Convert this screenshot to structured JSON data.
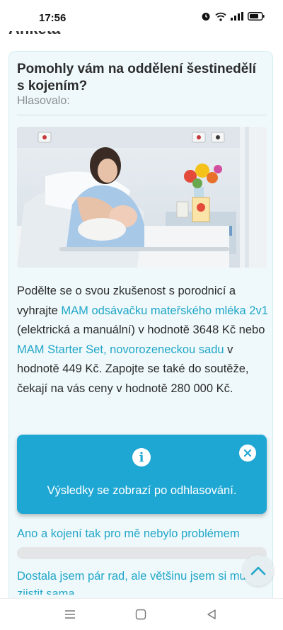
{
  "status": {
    "time": "17:56"
  },
  "page": {
    "heading": "Anketa"
  },
  "poll": {
    "question": "Pomohly vám na oddělení šestinedělí s kojením?",
    "voted_label": "Hlasovalo:",
    "description": {
      "p1": "Podělte se o svou zkušenost s porodnicí a vyhrajte ",
      "link1": "MAM odsávačku mateřského mléka 2v1",
      "p2": " (elektrická a manuální) v hodnotě 3648 Kč nebo ",
      "link2": "MAM Starter Set, novorozeneckou sadu",
      "p3": " v hodnotě 449 Kč. Zapojte se také do soutěže, čekají na vás ceny v hodnotě 280 000 Kč."
    },
    "info_box": {
      "text": "Výsledky se zobrazí po odhlasování."
    },
    "options": [
      {
        "label": "Ano a kojení tak pro mě nebylo problémem"
      },
      {
        "label": "Dostala jsem pár rad, ale většinu jsem si musela zjistit sama"
      }
    ]
  },
  "colors": {
    "accent": "#21a6c8",
    "info_bg": "#1fa7d4",
    "card_bg": "#eff9fb"
  },
  "icons": [
    "alarm-icon",
    "wifi-icon",
    "signal-icon",
    "battery-icon",
    "info-icon",
    "close-icon",
    "chevron-up-icon",
    "menu-icon",
    "home-icon",
    "back-icon"
  ]
}
